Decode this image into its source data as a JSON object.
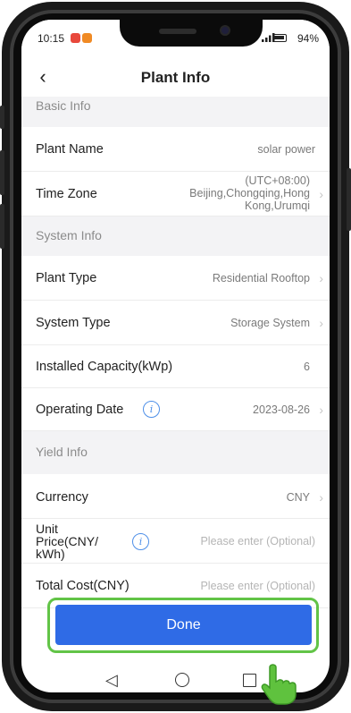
{
  "status_bar": {
    "time": "10:15",
    "battery": "94%"
  },
  "header": {
    "title": "Plant Info"
  },
  "sections": {
    "basic": "Basic Info",
    "system": "System Info",
    "yield": "Yield Info"
  },
  "rows": {
    "plant_name": {
      "label": "Plant Name",
      "value": "solar power"
    },
    "time_zone": {
      "label": "Time Zone",
      "value_line1": "(UTC+08:00)",
      "value_line2": "Beijing,Chongqing,Hong",
      "value_line3": "Kong,Urumqi"
    },
    "plant_type": {
      "label": "Plant Type",
      "value": "Residential Rooftop"
    },
    "system_type": {
      "label": "System Type",
      "value": "Storage System"
    },
    "installed_capacity": {
      "label": "Installed Capacity(kWp)",
      "value": "6"
    },
    "operating_date": {
      "label": "Operating Date",
      "value": "2023-08-26"
    },
    "currency": {
      "label": "Currency",
      "value": "CNY"
    },
    "unit_price": {
      "label_line1": "Unit",
      "label_line2": "Price(CNY/",
      "label_line3": "kWh)",
      "placeholder": "Please enter (Optional)"
    },
    "total_cost": {
      "label": "Total Cost(CNY)",
      "placeholder": "Please enter (Optional)"
    }
  },
  "done_button": {
    "label": "Done"
  },
  "icons": {
    "back": "chevron-left-icon",
    "info": "info-icon",
    "chevron": "chevron-right-icon",
    "nav_back": "triangle-back-icon",
    "nav_home": "circle-home-icon",
    "nav_recent": "square-recent-icon",
    "cursor": "hand-pointer-icon"
  },
  "colors": {
    "accent": "#2f6be6",
    "highlight": "#62c447",
    "info": "#4e8fe8"
  }
}
